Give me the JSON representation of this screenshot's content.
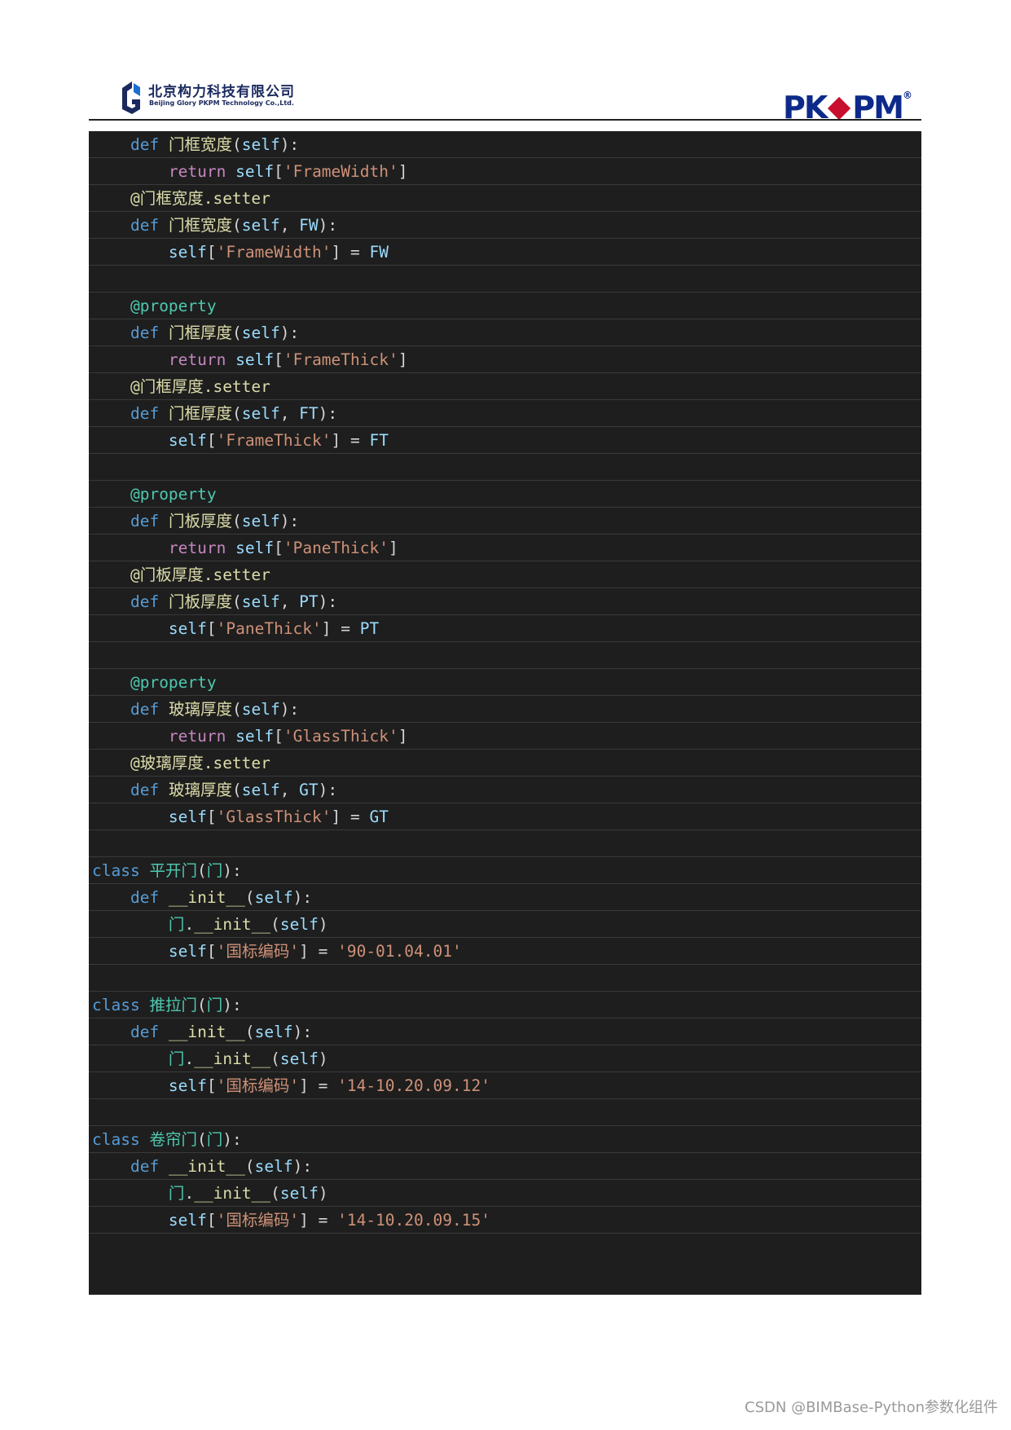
{
  "header": {
    "company_cn": "北京构力科技有限公司",
    "company_en": "Beijing Glory PKPM Technology Co.,Ltd.",
    "brand_left": "PK",
    "brand_right": "PM",
    "brand_reg": "®"
  },
  "code": {
    "lines": [
      [
        {
          "t": "    "
        },
        {
          "t": "def",
          "c": "kw"
        },
        {
          "t": " "
        },
        {
          "t": "门框宽度",
          "c": "fn"
        },
        {
          "t": "("
        },
        {
          "t": "self",
          "c": "sv"
        },
        {
          "t": "):"
        }
      ],
      [
        {
          "t": "        "
        },
        {
          "t": "return",
          "c": "ret"
        },
        {
          "t": " "
        },
        {
          "t": "self",
          "c": "sv"
        },
        {
          "t": "["
        },
        {
          "t": "'FrameWidth'",
          "c": "str"
        },
        {
          "t": "]"
        }
      ],
      [
        {
          "t": "    "
        },
        {
          "t": "@门框宽度.setter",
          "c": "deca"
        }
      ],
      [
        {
          "t": "    "
        },
        {
          "t": "def",
          "c": "kw"
        },
        {
          "t": " "
        },
        {
          "t": "门框宽度",
          "c": "fn"
        },
        {
          "t": "("
        },
        {
          "t": "self",
          "c": "sv"
        },
        {
          "t": ", "
        },
        {
          "t": "FW",
          "c": "sv"
        },
        {
          "t": "):"
        }
      ],
      [
        {
          "t": "        "
        },
        {
          "t": "self",
          "c": "sv"
        },
        {
          "t": "["
        },
        {
          "t": "'FrameWidth'",
          "c": "str"
        },
        {
          "t": "] = "
        },
        {
          "t": "FW",
          "c": "sv"
        }
      ],
      [],
      [
        {
          "t": "    "
        },
        {
          "t": "@property",
          "c": "dec"
        }
      ],
      [
        {
          "t": "    "
        },
        {
          "t": "def",
          "c": "kw"
        },
        {
          "t": " "
        },
        {
          "t": "门框厚度",
          "c": "fn"
        },
        {
          "t": "("
        },
        {
          "t": "self",
          "c": "sv"
        },
        {
          "t": "):"
        }
      ],
      [
        {
          "t": "        "
        },
        {
          "t": "return",
          "c": "ret"
        },
        {
          "t": " "
        },
        {
          "t": "self",
          "c": "sv"
        },
        {
          "t": "["
        },
        {
          "t": "'FrameThick'",
          "c": "str"
        },
        {
          "t": "]"
        }
      ],
      [
        {
          "t": "    "
        },
        {
          "t": "@门框厚度.setter",
          "c": "deca"
        }
      ],
      [
        {
          "t": "    "
        },
        {
          "t": "def",
          "c": "kw"
        },
        {
          "t": " "
        },
        {
          "t": "门框厚度",
          "c": "fn"
        },
        {
          "t": "("
        },
        {
          "t": "self",
          "c": "sv"
        },
        {
          "t": ", "
        },
        {
          "t": "FT",
          "c": "sv"
        },
        {
          "t": "):"
        }
      ],
      [
        {
          "t": "        "
        },
        {
          "t": "self",
          "c": "sv"
        },
        {
          "t": "["
        },
        {
          "t": "'FrameThick'",
          "c": "str"
        },
        {
          "t": "] = "
        },
        {
          "t": "FT",
          "c": "sv"
        }
      ],
      [],
      [
        {
          "t": "    "
        },
        {
          "t": "@property",
          "c": "dec"
        }
      ],
      [
        {
          "t": "    "
        },
        {
          "t": "def",
          "c": "kw"
        },
        {
          "t": " "
        },
        {
          "t": "门板厚度",
          "c": "fn"
        },
        {
          "t": "("
        },
        {
          "t": "self",
          "c": "sv"
        },
        {
          "t": "):"
        }
      ],
      [
        {
          "t": "        "
        },
        {
          "t": "return",
          "c": "ret"
        },
        {
          "t": " "
        },
        {
          "t": "self",
          "c": "sv"
        },
        {
          "t": "["
        },
        {
          "t": "'PaneThick'",
          "c": "str"
        },
        {
          "t": "]"
        }
      ],
      [
        {
          "t": "    "
        },
        {
          "t": "@门板厚度.setter",
          "c": "deca"
        }
      ],
      [
        {
          "t": "    "
        },
        {
          "t": "def",
          "c": "kw"
        },
        {
          "t": " "
        },
        {
          "t": "门板厚度",
          "c": "fn"
        },
        {
          "t": "("
        },
        {
          "t": "self",
          "c": "sv"
        },
        {
          "t": ", "
        },
        {
          "t": "PT",
          "c": "sv"
        },
        {
          "t": "):"
        }
      ],
      [
        {
          "t": "        "
        },
        {
          "t": "self",
          "c": "sv"
        },
        {
          "t": "["
        },
        {
          "t": "'PaneThick'",
          "c": "str"
        },
        {
          "t": "] = "
        },
        {
          "t": "PT",
          "c": "sv"
        }
      ],
      [],
      [
        {
          "t": "    "
        },
        {
          "t": "@property",
          "c": "dec"
        }
      ],
      [
        {
          "t": "    "
        },
        {
          "t": "def",
          "c": "kw"
        },
        {
          "t": " "
        },
        {
          "t": "玻璃厚度",
          "c": "fn"
        },
        {
          "t": "("
        },
        {
          "t": "self",
          "c": "sv"
        },
        {
          "t": "):"
        }
      ],
      [
        {
          "t": "        "
        },
        {
          "t": "return",
          "c": "ret"
        },
        {
          "t": " "
        },
        {
          "t": "self",
          "c": "sv"
        },
        {
          "t": "["
        },
        {
          "t": "'GlassThick'",
          "c": "str"
        },
        {
          "t": "]"
        }
      ],
      [
        {
          "t": "    "
        },
        {
          "t": "@玻璃厚度.setter",
          "c": "deca"
        }
      ],
      [
        {
          "t": "    "
        },
        {
          "t": "def",
          "c": "kw"
        },
        {
          "t": " "
        },
        {
          "t": "玻璃厚度",
          "c": "fn"
        },
        {
          "t": "("
        },
        {
          "t": "self",
          "c": "sv"
        },
        {
          "t": ", "
        },
        {
          "t": "GT",
          "c": "sv"
        },
        {
          "t": "):"
        }
      ],
      [
        {
          "t": "        "
        },
        {
          "t": "self",
          "c": "sv"
        },
        {
          "t": "["
        },
        {
          "t": "'GlassThick'",
          "c": "str"
        },
        {
          "t": "] = "
        },
        {
          "t": "GT",
          "c": "sv"
        }
      ],
      [],
      [
        {
          "t": "class",
          "c": "kw"
        },
        {
          "t": " "
        },
        {
          "t": "平开门",
          "c": "cls"
        },
        {
          "t": "("
        },
        {
          "t": "门",
          "c": "cls"
        },
        {
          "t": "):"
        }
      ],
      [
        {
          "t": "    "
        },
        {
          "t": "def",
          "c": "kw"
        },
        {
          "t": " "
        },
        {
          "t": "__init__",
          "c": "fn"
        },
        {
          "t": "("
        },
        {
          "t": "self",
          "c": "sv"
        },
        {
          "t": "):"
        }
      ],
      [
        {
          "t": "        "
        },
        {
          "t": "门",
          "c": "cls"
        },
        {
          "t": "."
        },
        {
          "t": "__init__",
          "c": "fn"
        },
        {
          "t": "("
        },
        {
          "t": "self",
          "c": "sv"
        },
        {
          "t": ")"
        }
      ],
      [
        {
          "t": "        "
        },
        {
          "t": "self",
          "c": "sv"
        },
        {
          "t": "["
        },
        {
          "t": "'国标编码'",
          "c": "str"
        },
        {
          "t": "] = "
        },
        {
          "t": "'90-01.04.01'",
          "c": "str"
        }
      ],
      [],
      [
        {
          "t": "class",
          "c": "kw"
        },
        {
          "t": " "
        },
        {
          "t": "推拉门",
          "c": "cls"
        },
        {
          "t": "("
        },
        {
          "t": "门",
          "c": "cls"
        },
        {
          "t": "):"
        }
      ],
      [
        {
          "t": "    "
        },
        {
          "t": "def",
          "c": "kw"
        },
        {
          "t": " "
        },
        {
          "t": "__init__",
          "c": "fn"
        },
        {
          "t": "("
        },
        {
          "t": "self",
          "c": "sv"
        },
        {
          "t": "):"
        }
      ],
      [
        {
          "t": "        "
        },
        {
          "t": "门",
          "c": "cls"
        },
        {
          "t": "."
        },
        {
          "t": "__init__",
          "c": "fn"
        },
        {
          "t": "("
        },
        {
          "t": "self",
          "c": "sv"
        },
        {
          "t": ")"
        }
      ],
      [
        {
          "t": "        "
        },
        {
          "t": "self",
          "c": "sv"
        },
        {
          "t": "["
        },
        {
          "t": "'国标编码'",
          "c": "str"
        },
        {
          "t": "] = "
        },
        {
          "t": "'14-10.20.09.12'",
          "c": "str"
        }
      ],
      [],
      [
        {
          "t": "class",
          "c": "kw"
        },
        {
          "t": " "
        },
        {
          "t": "卷帘门",
          "c": "cls"
        },
        {
          "t": "("
        },
        {
          "t": "门",
          "c": "cls"
        },
        {
          "t": "):"
        }
      ],
      [
        {
          "t": "    "
        },
        {
          "t": "def",
          "c": "kw"
        },
        {
          "t": " "
        },
        {
          "t": "__init__",
          "c": "fn"
        },
        {
          "t": "("
        },
        {
          "t": "self",
          "c": "sv"
        },
        {
          "t": "):"
        }
      ],
      [
        {
          "t": "        "
        },
        {
          "t": "门",
          "c": "cls"
        },
        {
          "t": "."
        },
        {
          "t": "__init__",
          "c": "fn"
        },
        {
          "t": "("
        },
        {
          "t": "self",
          "c": "sv"
        },
        {
          "t": ")"
        }
      ],
      [
        {
          "t": "        "
        },
        {
          "t": "self",
          "c": "sv"
        },
        {
          "t": "["
        },
        {
          "t": "'国标编码'",
          "c": "str"
        },
        {
          "t": "] = "
        },
        {
          "t": "'14-10.20.09.15'",
          "c": "str"
        }
      ],
      []
    ]
  },
  "watermark": "CSDN @BIMBase-Python参数化组件"
}
